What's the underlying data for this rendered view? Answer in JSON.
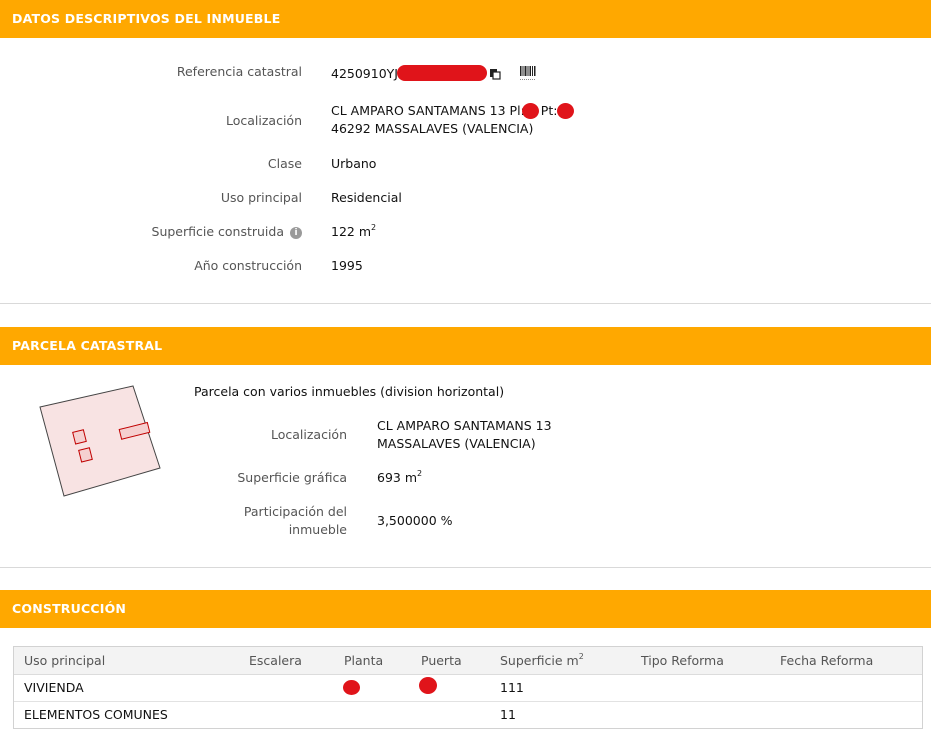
{
  "descriptive": {
    "header": "DATOS DESCRIPTIVOS DEL INMUEBLE",
    "ref_label": "Referencia catastral",
    "ref_value": "4250910YJ",
    "loc_label": "Localización",
    "loc_line1": "CL AMPARO SANTAMANS 13 Pl:",
    "loc_pt": "Pt:",
    "loc_line2": "46292 MASSALAVES (VALENCIA)",
    "clase_label": "Clase",
    "clase_value": "Urbano",
    "uso_label": "Uso principal",
    "uso_value": "Residencial",
    "sup_label": "Superficie construida",
    "sup_value": "122 m",
    "sup_exp": "2",
    "anio_label": "Año construcción",
    "anio_value": "1995",
    "info_icon_glyph": "i"
  },
  "parcela": {
    "header": "PARCELA CATASTRAL",
    "title": "Parcela con varios inmuebles (division horizontal)",
    "loc_label": "Localización",
    "loc_line1": "CL AMPARO SANTAMANS 13",
    "loc_line2": "MASSALAVES (VALENCIA)",
    "sup_label": "Superficie gráfica",
    "sup_value": "693 m",
    "sup_exp": "2",
    "part_label_1": "Participación del",
    "part_label_2": "inmueble",
    "part_value": "3,500000 %"
  },
  "construccion": {
    "header": "CONSTRUCCIÓN",
    "columns": [
      "Uso principal",
      "Escalera",
      "Planta",
      "Puerta",
      "Superficie m",
      "Tipo Reforma",
      "Fecha Reforma"
    ],
    "sup_col_exp": "2",
    "rows": [
      {
        "uso": "VIVIENDA",
        "escalera": "",
        "superficie": "111"
      },
      {
        "uso": "ELEMENTOS COMUNES",
        "escalera": "",
        "superficie": "11"
      }
    ]
  },
  "colors": {
    "header_bg": "#ffa800",
    "redaction": "#e0141a",
    "parcel_fill": "#f8e3e3",
    "parcel_unit_stroke": "#c00000"
  }
}
